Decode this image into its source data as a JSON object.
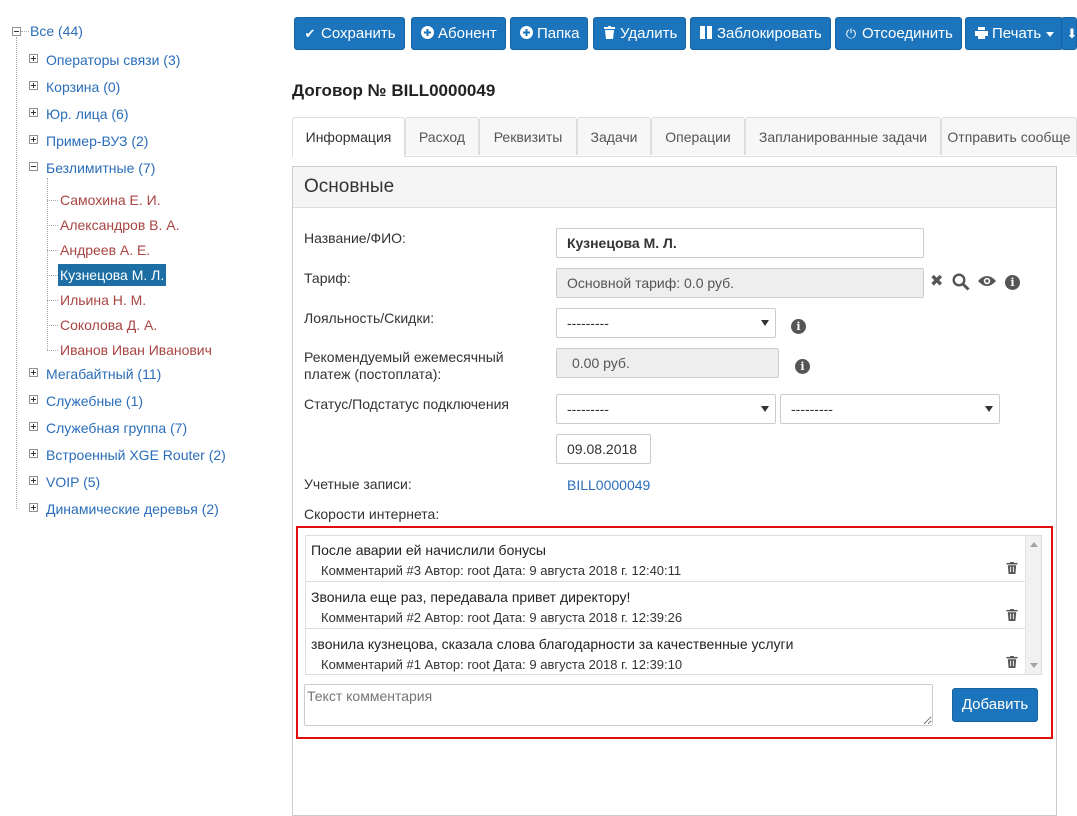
{
  "tree": {
    "root": {
      "label": "Все (44)"
    },
    "groups_top": [
      {
        "label": "Операторы связи (3)"
      },
      {
        "label": "Корзина (0)"
      },
      {
        "label": "Юр. лица (6)"
      },
      {
        "label": "Пример-ВУЗ (2)"
      },
      {
        "label": "Безлимитные (7)"
      }
    ],
    "leaves": [
      {
        "label": "Самохина Е. И.",
        "selected": false
      },
      {
        "label": "Александров В. А.",
        "selected": false
      },
      {
        "label": "Андреев А. Е.",
        "selected": false
      },
      {
        "label": "Кузнецова М. Л.",
        "selected": true
      },
      {
        "label": "Ильина Н. М.",
        "selected": false
      },
      {
        "label": "Соколова Д. А.",
        "selected": false
      },
      {
        "label": "Иванов Иван Иванович",
        "selected": false
      }
    ],
    "groups_bottom": [
      {
        "label": "Мегабайтный (11)"
      },
      {
        "label": "Служебные (1)"
      },
      {
        "label": "Служебная группа (7)"
      },
      {
        "label": "Встроенный XGE Router (2)"
      },
      {
        "label": "VOIP (5)"
      },
      {
        "label": "Динамические деревья (2)"
      }
    ]
  },
  "toolbar": {
    "save": "Сохранить",
    "subscriber": "Абонент",
    "folder": "Папка",
    "delete": "Удалить",
    "block": "Заблокировать",
    "disconnect": "Отсоединить",
    "print": "Печать"
  },
  "page_title": "Договор № BILL0000049",
  "tabs": [
    {
      "label": "Информация",
      "active": true
    },
    {
      "label": "Расход"
    },
    {
      "label": "Реквизиты"
    },
    {
      "label": "Задачи"
    },
    {
      "label": "Операции"
    },
    {
      "label": "Запланированные задачи"
    },
    {
      "label": "Отправить сообще"
    }
  ],
  "panel": {
    "title": "Основные",
    "labels": {
      "name": "Название/ФИО:",
      "tariff": "Тариф:",
      "loyalty": "Лояльность/Скидки:",
      "payment_1": "Рекомендуемый ежемесячный",
      "payment_2": "платеж (постоплата):",
      "status": "Статус/Подстатус подключения",
      "accounts": "Учетные записи:",
      "speeds": "Скорости интернета:"
    },
    "values": {
      "name": "Кузнецова М. Л.",
      "tariff": "Основной тариф:   0.0 руб.",
      "loyalty": "---------",
      "payment": "0.00 руб.",
      "status": "---------",
      "substatus": "---------",
      "date": "09.08.2018",
      "account": "BILL0000049"
    }
  },
  "comments": {
    "items": [
      {
        "text": "После аварии ей начислили бонусы",
        "meta": "Комментарий #3 Автор: root Дата: 9 августа 2018 г. 12:40:11"
      },
      {
        "text": "Звонила еще раз, передавала привет директору!",
        "meta": "Комментарий #2 Автор: root Дата: 9 августа 2018 г. 12:39:26"
      },
      {
        "text": "звонила кузнецова, сказала слова благодарности за качественные услуги",
        "meta": "Комментарий #1 Автор: root Дата: 9 августа 2018 г. 12:39:10"
      }
    ],
    "placeholder": "Текст комментария",
    "add_label": "Добавить"
  },
  "colors": {
    "primary": "#1c75bc",
    "link": "#2a6ebb",
    "leaf": "#a94442",
    "highlight_border": "#e00d0d"
  }
}
